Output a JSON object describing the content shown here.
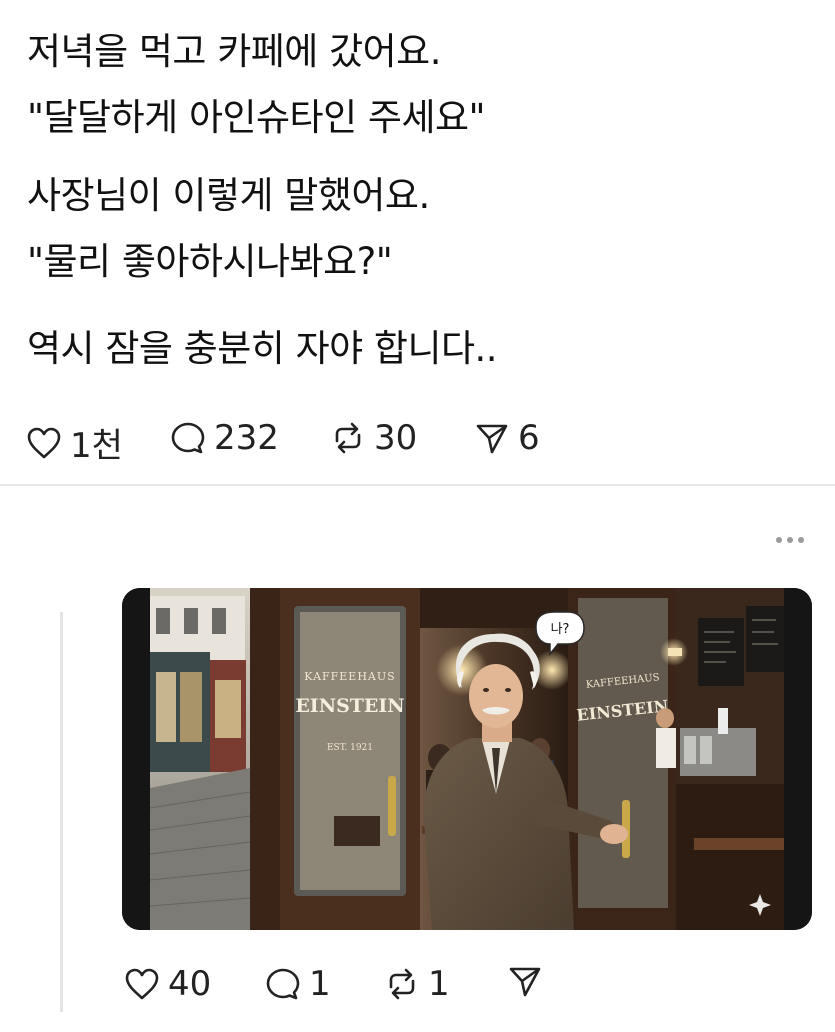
{
  "post": {
    "lines": [
      "저녁을 먹고 카페에 갔어요.",
      "\"달달하게 아인슈타인 주세요\"",
      "사장님이 이렇게 말했어요.",
      "\"물리 좋아하시나봐요?\"",
      "역시 잠을 충분히 자야 합니다.."
    ],
    "likes": "1천",
    "comments": "232",
    "reposts": "30",
    "shares": "6"
  },
  "reply": {
    "image": {
      "sign_line1": "KAFFEEHAUS",
      "sign_line2": "EINSTEIN",
      "sign_line3": "EST. 1921",
      "speech_bubble": "나?"
    },
    "likes": "40",
    "comments": "1",
    "reposts": "1"
  },
  "icons": {
    "like": "heart-icon",
    "comment": "comment-bubble-icon",
    "repost": "repost-icon",
    "share": "send-icon",
    "more": "more-dots-icon",
    "sparkle": "sparkle-icon"
  }
}
